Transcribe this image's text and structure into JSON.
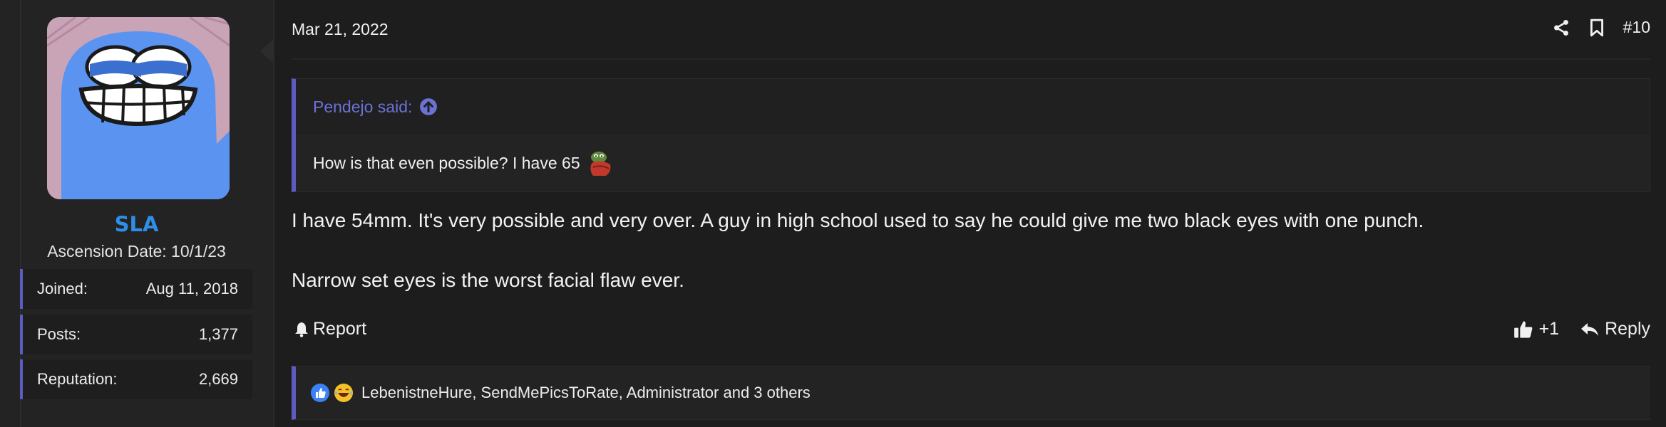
{
  "user": {
    "name": "SLA",
    "title": "Ascension Date: 10/1/23",
    "stats": [
      {
        "label": "Joined:",
        "value": "Aug 11, 2018"
      },
      {
        "label": "Posts:",
        "value": "1,377"
      },
      {
        "label": "Reputation:",
        "value": "2,669"
      }
    ]
  },
  "post": {
    "date": "Mar 21, 2022",
    "permalink": "#10",
    "quote": {
      "author": "Pendejo said:",
      "text": "How is that even possible? I have 65"
    },
    "body": [
      "I have 54mm. It's very possible and very over. A guy in high school used to say he could give me two black eyes with one punch.",
      "Narrow set eyes is the worst facial flaw ever."
    ]
  },
  "actions": {
    "report": "Report",
    "like_count": "+1",
    "reply": "Reply"
  },
  "reactions": {
    "list": "LebenistneHure, SendMePicsToRate, Administrator and 3 others"
  },
  "colors": {
    "accent": "#5c5cc0",
    "username": "#2f8ee8",
    "quote_author": "#6b72d6",
    "background": "#1d1d1d"
  },
  "icons": [
    "share-icon",
    "bookmark-icon",
    "arrow-up-circle-icon",
    "bell-icon",
    "thumbs-up-icon",
    "reply-icon",
    "like-reaction-icon",
    "laugh-reaction-icon",
    "pepe-emoji-icon"
  ]
}
